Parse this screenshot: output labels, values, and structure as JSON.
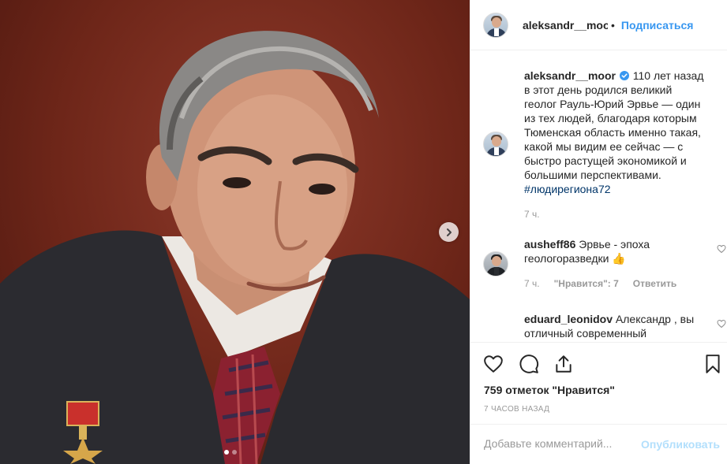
{
  "post": {
    "image_alt_icon": "portrait-photo",
    "carousel": {
      "total": 2,
      "active": 0
    }
  },
  "header": {
    "username": "aleksandr__moor",
    "separator": "•",
    "follow_label": "Подписаться",
    "more_icon": "more-icon"
  },
  "caption": {
    "username": "aleksandr__moor",
    "text": "110 лет назад в этот день родился великий геолог Рауль-Юрий Эрвье — один из тех людей, благодаря которым Тюменская область именно такая, какой мы видим ее сейчас — с быстро растущей экономикой и большими перспективами.",
    "hashtag": "#людирегиона72",
    "time": "7 ч."
  },
  "comments": [
    {
      "username": "ausheff86",
      "text": "Эрвье - эпоха геологоразведки",
      "emoji": "👍",
      "time": "7 ч.",
      "likes_label": "\"Нравится\": 7",
      "reply_label": "Ответить"
    },
    {
      "username": "eduard_leonidov",
      "text": "Александр , вы отличный современный"
    }
  ],
  "likes_text": "759 отметок \"Нравится\"",
  "timestamp": "7 ЧАСОВ НАЗАД",
  "add_comment": {
    "placeholder": "Добавьте комментарий...",
    "publish_label": "Опубликовать"
  },
  "colors": {
    "accent": "#3897f0",
    "publish_disabled": "#b2dffc",
    "muted": "#999999"
  }
}
